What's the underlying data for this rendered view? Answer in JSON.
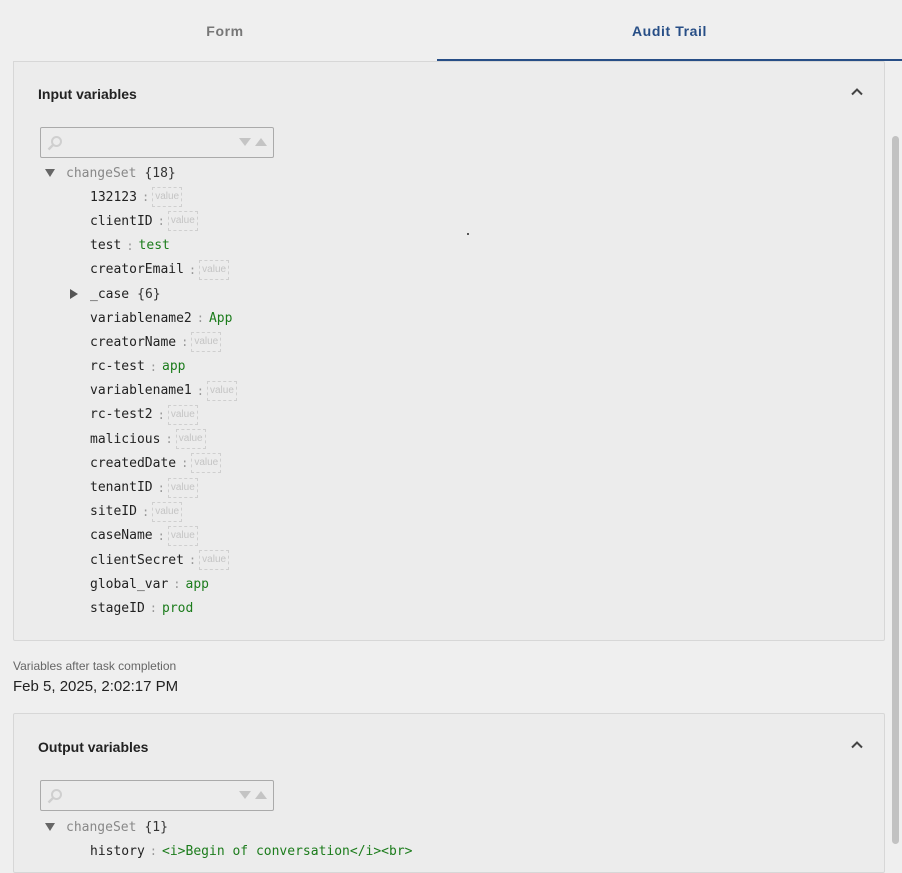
{
  "tabs": {
    "form": "Form",
    "audit_trail": "Audit Trail"
  },
  "input_panel": {
    "title": "Input variables",
    "search": {
      "value": "",
      "placeholder": ""
    },
    "root": {
      "key": "changeSet",
      "count": "{18}"
    },
    "entries": [
      {
        "key": "132123",
        "value": "value",
        "empty": true
      },
      {
        "key": "clientID",
        "value": "value",
        "empty": true
      },
      {
        "key": "test",
        "value": "test",
        "empty": false
      },
      {
        "key": "creatorEmail",
        "value": "value",
        "empty": true
      },
      {
        "key": "_case",
        "count": "{6}",
        "collapsed": true
      },
      {
        "key": "variablename2",
        "value": "App",
        "empty": false
      },
      {
        "key": "creatorName",
        "value": "value",
        "empty": true
      },
      {
        "key": "rc-test",
        "value": "app",
        "empty": false
      },
      {
        "key": "variablename1",
        "value": "value",
        "empty": true
      },
      {
        "key": "rc-test2",
        "value": "value",
        "empty": true
      },
      {
        "key": "malicious",
        "value": "value",
        "empty": true
      },
      {
        "key": "createdDate",
        "value": "value",
        "empty": true
      },
      {
        "key": "tenantID",
        "value": "value",
        "empty": true
      },
      {
        "key": "siteID",
        "value": "value",
        "empty": true
      },
      {
        "key": "caseName",
        "value": "value",
        "empty": true
      },
      {
        "key": "clientSecret",
        "value": "value",
        "empty": true
      },
      {
        "key": "global_var",
        "value": "app",
        "empty": false
      },
      {
        "key": "stageID",
        "value": "prod",
        "empty": false
      }
    ]
  },
  "after": {
    "label": "Variables after task completion",
    "date": "Feb 5, 2025, 2:02:17 PM"
  },
  "output_panel": {
    "title": "Output variables",
    "search": {
      "value": "",
      "placeholder": ""
    },
    "root": {
      "key": "changeSet",
      "count": "{1}"
    },
    "entries": [
      {
        "key": "history",
        "value": "<i>Begin of conversation</i><br>",
        "empty": false
      }
    ]
  },
  "icons": {
    "search": "search-icon",
    "collapse": "chevron-up-icon",
    "expanded": "caret-down-icon",
    "collapsed": "caret-right-icon",
    "sort_down": "sort-down-icon",
    "sort_up": "sort-up-icon"
  },
  "colors": {
    "accent": "#274e86",
    "string_value": "#1c7c1c"
  }
}
